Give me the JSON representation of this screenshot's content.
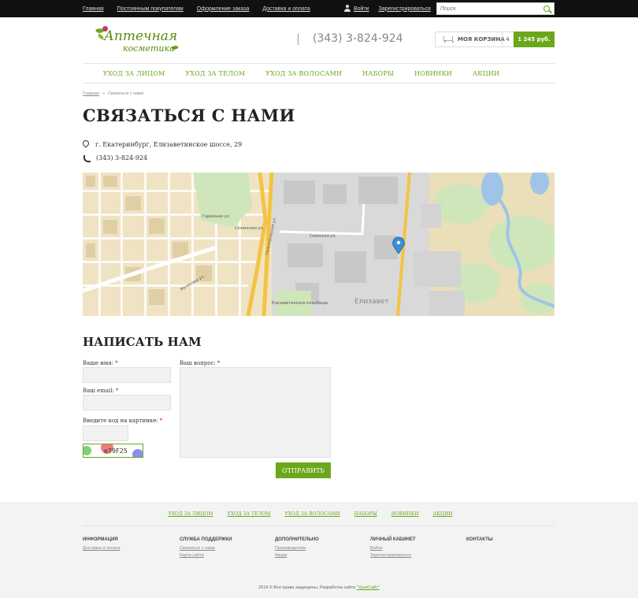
{
  "topbar": {
    "nav": [
      "Главная",
      "Постоянным покупателям",
      "Оформление заказа",
      "Доставка и оплата"
    ],
    "login": "Войти",
    "register": "Зарегистрироваться",
    "search_placeholder": "Поиск"
  },
  "header": {
    "logo_line1": "Аптечная",
    "logo_line2": "косметика",
    "phone": "(343) 3-824-924",
    "cart_label": "МОЯ КОРЗИНА",
    "cart_count": "4",
    "cart_sum": "1 245 руб."
  },
  "mainnav": [
    "УХОД ЗА ЛИЦОМ",
    "УХОД ЗА ТЕЛОМ",
    "УХОД ЗА ВОЛОСАМИ",
    "НАБОРЫ",
    "НОВИНКИ",
    "АКЦИИ"
  ],
  "breadcrumb": [
    "Главная",
    "»",
    "Связаться с нами"
  ],
  "page": {
    "title": "СВЯЗАТЬСЯ С НАМИ",
    "address": "г. Екатеринбург, Елизаветинское шоссе, 29",
    "phone": "(343) 3-824-924"
  },
  "map": {
    "labels": [
      "Гаражная ул.",
      "Сочинская ул.",
      "Сиянская ул.",
      "Селькоровская ул.",
      "Елизаветинское кладбище",
      "Елизавет",
      "Мулисова ул."
    ]
  },
  "form": {
    "title": "НАПИСАТЬ НАМ",
    "name_label": "Ваше имя:",
    "email_label": "Ваш email:",
    "captcha_label": "Введите код на картинке:",
    "question_label": "Ваш вопрос:",
    "required_mark": "*",
    "captcha_code": "e79F25",
    "submit": "ОТПРАВИТЬ"
  },
  "footer": {
    "nav": [
      "УХОД ЗА ЛИЦОМ",
      "УХОД ЗА ТЕЛОМ",
      "УХОД ЗА ВОЛОСАМИ",
      "НАБОРЫ",
      "НОВИНКИ",
      "АКЦИИ"
    ],
    "columns": [
      {
        "heading": "ИНФОРМАЦИЯ",
        "items": [
          "Доставка и оплата"
        ]
      },
      {
        "heading": "СЛУЖБА ПОДДЕРЖКИ",
        "items": [
          "Связаться с нами",
          "Карта сайта"
        ]
      },
      {
        "heading": "ДОПОЛНИТЕЛЬНО",
        "items": [
          "Производители",
          "Акции"
        ]
      },
      {
        "heading": "ЛИЧНЫЙ КАБИНЕТ",
        "items": [
          "Войти",
          "Зарегистрироваться"
        ]
      },
      {
        "heading": "КОНТАКТЫ",
        "items": []
      }
    ],
    "copyright": "2014 © Все права защищены. Разработка сайта",
    "dev_link": "\"УралСайт\""
  },
  "colors": {
    "accent": "#6aa71b",
    "topbar": "#111111",
    "footer_bg": "#f3f3f3"
  }
}
